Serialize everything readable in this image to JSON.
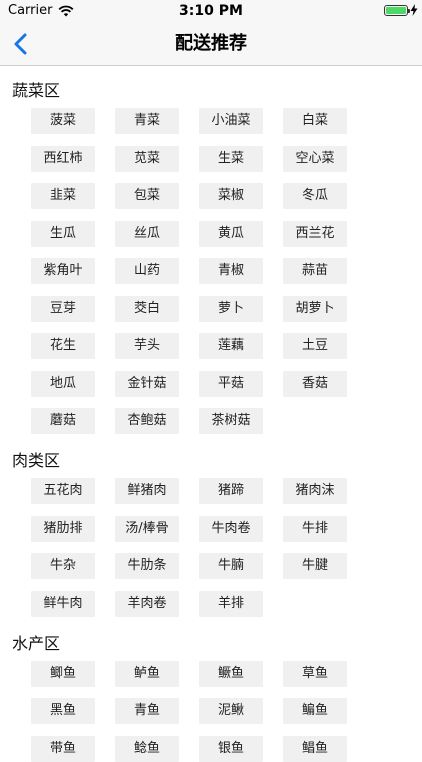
{
  "status_bar": {
    "carrier": "Carrier",
    "time": "3:10 PM",
    "battery_level": 1.0,
    "battery_color": "#4cd964"
  },
  "nav": {
    "title": "配送推荐",
    "back_icon": "chevron-left-icon",
    "accent_color": "#1a73e8"
  },
  "sections": [
    {
      "title": "蔬菜区",
      "items": [
        "菠菜",
        "青菜",
        "小油菜",
        "白菜",
        "西红柿",
        "苋菜",
        "生菜",
        "空心菜",
        "韭菜",
        "包菜",
        "菜椒",
        "冬瓜",
        "生瓜",
        "丝瓜",
        "黄瓜",
        "西兰花",
        "紫角叶",
        "山药",
        "青椒",
        "蒜苗",
        "豆芽",
        "茭白",
        "萝卜",
        "胡萝卜",
        "花生",
        "芋头",
        "莲藕",
        "土豆",
        "地瓜",
        "金针菇",
        "平菇",
        "香菇",
        "蘑菇",
        "杏鲍菇",
        "茶树菇"
      ]
    },
    {
      "title": "肉类区",
      "items": [
        "五花肉",
        "鲜猪肉",
        "猪蹄",
        "猪肉沫",
        "猪肋排",
        "汤/棒骨",
        "牛肉卷",
        "牛排",
        "牛杂",
        "牛肋条",
        "牛腩",
        "牛腱",
        "鲜牛肉",
        "羊肉卷",
        "羊排"
      ]
    },
    {
      "title": "水产区",
      "items": [
        "鲫鱼",
        "鲈鱼",
        "鳜鱼",
        "草鱼",
        "黑鱼",
        "青鱼",
        "泥鳅",
        "鳊鱼",
        "带鱼",
        "鲶鱼",
        "银鱼",
        "鲳鱼"
      ]
    }
  ]
}
